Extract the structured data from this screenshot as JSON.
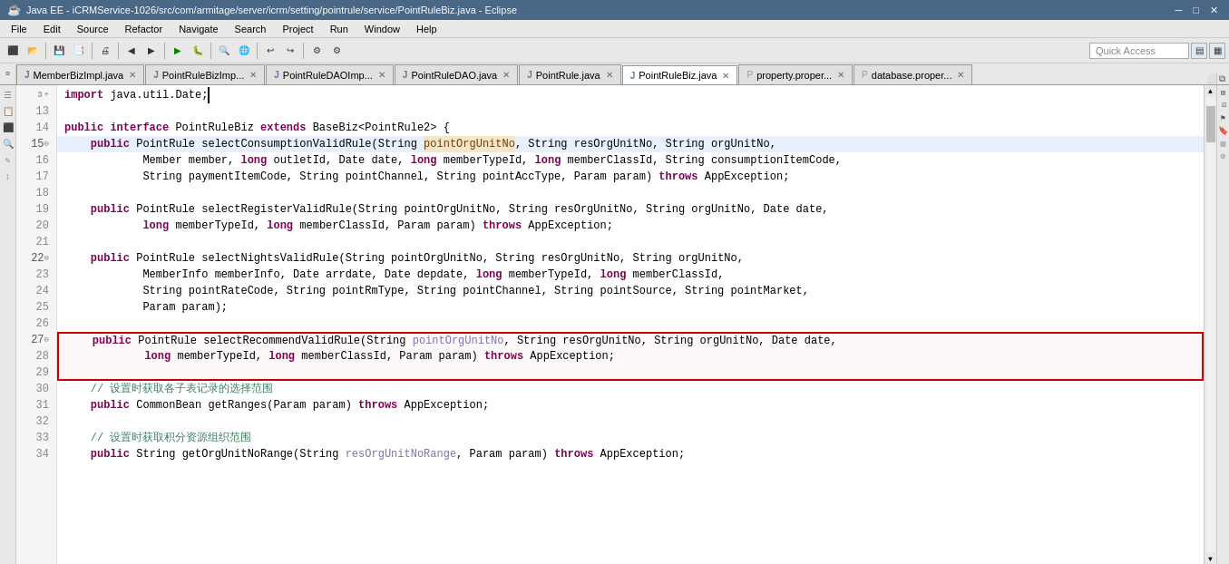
{
  "titlebar": {
    "title": "Java EE - iCRMService-1026/src/com/armitage/server/icrm/setting/pointrule/service/PointRuleBiz.java - Eclipse",
    "minimize": "─",
    "maximize": "□",
    "close": "✕"
  },
  "menubar": {
    "items": [
      "File",
      "Edit",
      "Source",
      "Refactor",
      "Navigate",
      "Search",
      "Project",
      "Run",
      "Window",
      "Help"
    ]
  },
  "toolbar": {
    "quick_access_placeholder": "Quick Access"
  },
  "tabs": [
    {
      "id": "tab1",
      "label": "MemberBizImpl.java",
      "active": false,
      "icon": "J"
    },
    {
      "id": "tab2",
      "label": "PointRuleBizImp...",
      "active": false,
      "icon": "J"
    },
    {
      "id": "tab3",
      "label": "PointRuleDAOImp...",
      "active": false,
      "icon": "J"
    },
    {
      "id": "tab4",
      "label": "PointRuleDAO.java",
      "active": false,
      "icon": "J"
    },
    {
      "id": "tab5",
      "label": "PointRule.java",
      "active": false,
      "icon": "J"
    },
    {
      "id": "tab6",
      "label": "PointRuleBiz.java",
      "active": true,
      "icon": "J"
    },
    {
      "id": "tab7",
      "label": "property.proper...",
      "active": false,
      "icon": "P"
    },
    {
      "id": "tab8",
      "label": "database.proper...",
      "active": false,
      "icon": "P"
    }
  ],
  "code": {
    "lines": [
      {
        "num": "3",
        "mark": "+",
        "content": "import java.util.Date;█"
      },
      {
        "num": "13",
        "mark": "",
        "content": ""
      },
      {
        "num": "14",
        "mark": "",
        "content": "public interface PointRuleBiz extends BaseBiz<PointRule2> {"
      },
      {
        "num": "15",
        "mark": "⊖",
        "content": "    public PointRule selectConsumptionValidRule(String pointOrgUnitNo, String resOrgUnitNo, String orgUnitNo,"
      },
      {
        "num": "16",
        "mark": "",
        "content": "            Member member, long outletId, Date date, long memberTypeId, long memberClassId, String consumptionItemCode,"
      },
      {
        "num": "17",
        "mark": "",
        "content": "            String paymentItemCode, String pointChannel, String pointAccType, Param param) throws AppException;"
      },
      {
        "num": "18",
        "mark": "",
        "content": ""
      },
      {
        "num": "19",
        "mark": "",
        "content": "    public PointRule selectRegisterValidRule(String pointOrgUnitNo, String resOrgUnitNo, String orgUnitNo, Date date,"
      },
      {
        "num": "20",
        "mark": "",
        "content": "            long memberTypeId, long memberClassId, Param param) throws AppException;"
      },
      {
        "num": "21",
        "mark": "",
        "content": ""
      },
      {
        "num": "22",
        "mark": "⊖",
        "content": "    public PointRule selectNightsValidRule(String pointOrgUnitNo, String resOrgUnitNo, String orgUnitNo,"
      },
      {
        "num": "23",
        "mark": "",
        "content": "            MemberInfo memberInfo, Date arrdate, Date depdate, long memberTypeId, long memberClassId,"
      },
      {
        "num": "24",
        "mark": "",
        "content": "            String pointRateCode, String pointRmType, String pointChannel, String pointSource, String pointMarket,"
      },
      {
        "num": "25",
        "mark": "",
        "content": "            Param param);"
      },
      {
        "num": "26",
        "mark": "",
        "content": ""
      },
      {
        "num": "27",
        "mark": "⊖",
        "content": "    public PointRule selectRecommendValidRule(String pointOrgUnitNo, String resOrgUnitNo, String orgUnitNo, Date date,"
      },
      {
        "num": "28",
        "mark": "",
        "content": "            long memberTypeId, long memberClassId, Param param) throws AppException;"
      },
      {
        "num": "29",
        "mark": "",
        "content": ""
      },
      {
        "num": "30",
        "mark": "",
        "content": "    // 设置时获取各子表记录的选择范围"
      },
      {
        "num": "31",
        "mark": "",
        "content": "    public CommonBean getRanges(Param param) throws AppException;"
      },
      {
        "num": "32",
        "mark": "",
        "content": ""
      },
      {
        "num": "33",
        "mark": "",
        "content": "    // 设置时获取积分资源组织范围"
      },
      {
        "num": "34",
        "mark": "",
        "content": "    public String getOrgUnitNoRange(String resOrgUnitNoRange, Param param) throws AppException;"
      }
    ]
  }
}
